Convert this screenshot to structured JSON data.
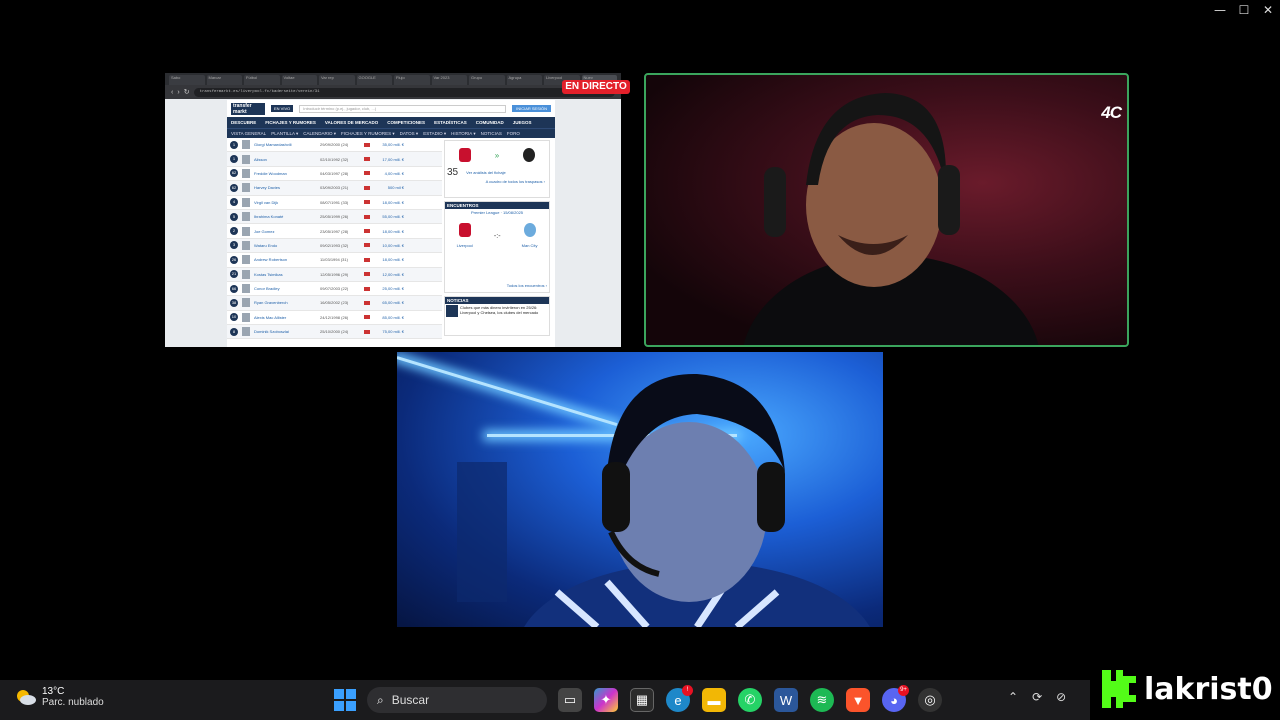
{
  "window": {
    "controls": [
      "—",
      "☐",
      "✕"
    ]
  },
  "browser": {
    "tabs": [
      "Sabo",
      "Marcar",
      "Fútbol",
      "Voltae",
      "Var rep",
      "GOOGLE",
      "Flujo",
      "Var 2023",
      "Grupo",
      "Agrupa",
      "Liverpool",
      "Nuev"
    ],
    "url": "transfermarkt.es/liverpool-fc/kaderseite/verein/31",
    "search_placeholder": "Introducir término (p.ej., jugador, club, ...)",
    "login": "INICIAR SESIÓN",
    "envivo": "EN VIVO",
    "logo": "transfer markt",
    "nav": [
      "DESCUBRE",
      "FICHAJES Y RUMORES",
      "VALORES DE MERCADO",
      "COMPETICIONES",
      "ESTADÍSTICAS",
      "COMUNIDAD",
      "JUEGOS"
    ],
    "subnav": [
      "VISTA GENERAL",
      "PLANTILLA ▾",
      "CALENDARIO ▾",
      "FICHAJES Y RUMORES ▾",
      "DATOS ▾",
      "ESTADIO ▾",
      "HISTORIA ▾",
      "NOTICIAS",
      "FORO"
    ],
    "rows": [
      {
        "num": "1",
        "name": "Giorgi Mamardashvili",
        "date": "29/09/2000 (24)",
        "value": "35,00 mill. €"
      },
      {
        "num": "1",
        "name": "Alisson",
        "date": "02/10/1992 (32)",
        "value": "17,00 mill. €"
      },
      {
        "num": "62",
        "name": "Freddie Woodman",
        "date": "04/03/1997 (28)",
        "value": "4,00 mill. €"
      },
      {
        "num": "62",
        "name": "Harvey Davies",
        "date": "03/09/2003 (21)",
        "value": "500 mil €"
      },
      {
        "num": "4",
        "name": "Virgil van Dijk",
        "date": "08/07/1991 (33)",
        "value": "18,00 mill. €"
      },
      {
        "num": "5",
        "name": "Ibrahima Konaté",
        "date": "25/05/1999 (26)",
        "value": "55,00 mill. €"
      },
      {
        "num": "2",
        "name": "Joe Gomez",
        "date": "23/05/1997 (28)",
        "value": "18,00 mill. €"
      },
      {
        "num": "3",
        "name": "Wataru Endo",
        "date": "09/02/1993 (32)",
        "value": "10,00 mill. €"
      },
      {
        "num": "26",
        "name": "Andrew Robertson",
        "date": "11/03/1994 (31)",
        "value": "18,00 mill. €"
      },
      {
        "num": "21",
        "name": "Kostas Tsimikas",
        "date": "12/05/1996 (29)",
        "value": "12,00 mill. €"
      },
      {
        "num": "66",
        "name": "Conor Bradley",
        "date": "09/07/2003 (22)",
        "value": "25,00 mill. €"
      },
      {
        "num": "38",
        "name": "Ryan Gravenberch",
        "date": "16/05/2002 (23)",
        "value": "65,00 mill. €"
      },
      {
        "num": "10",
        "name": "Alexis Mac Allister",
        "date": "24/12/1998 (26)",
        "value": "85,00 mill. €"
      },
      {
        "num": "8",
        "name": "Dominik Szoboszlai",
        "date": "25/10/2000 (24)",
        "value": "75,00 mill. €"
      }
    ],
    "side": {
      "rating": "35",
      "transfer_link": "Ver análisis del fichaje",
      "all_transfers": "A cuadro de todos los traspasos ›",
      "matches_header": "ENCUENTROS",
      "league": "Premier League",
      "match_date": "15/08/2025",
      "home": "Liverpool",
      "away": "Man City",
      "score": "-:-",
      "all_matches": "Todos los encuentros ›",
      "news_header": "NOTICIAS",
      "news_text": "Clubes que más dinero invirtieron en 25/26: Liverpool y Chelsea, los clubes del mercado"
    }
  },
  "live_badge": "EN DIRECTO",
  "cam1": {
    "logo": "4C"
  },
  "taskbar": {
    "temp": "13°C",
    "condition": "Parc. nublado",
    "search": "Buscar",
    "icons": [
      "task-view",
      "copilot",
      "store",
      "edge",
      "explorer",
      "whatsapp",
      "word",
      "spotify",
      "brave",
      "discord",
      "obs"
    ],
    "badges": {
      "edge": "!",
      "discord": "9+"
    }
  },
  "kick": {
    "name": "lakrist0"
  },
  "colors": {
    "accent": "#53fc18",
    "live": "#e3202a",
    "speaking": "#3ba55d",
    "tm_navy": "#1d3557"
  }
}
